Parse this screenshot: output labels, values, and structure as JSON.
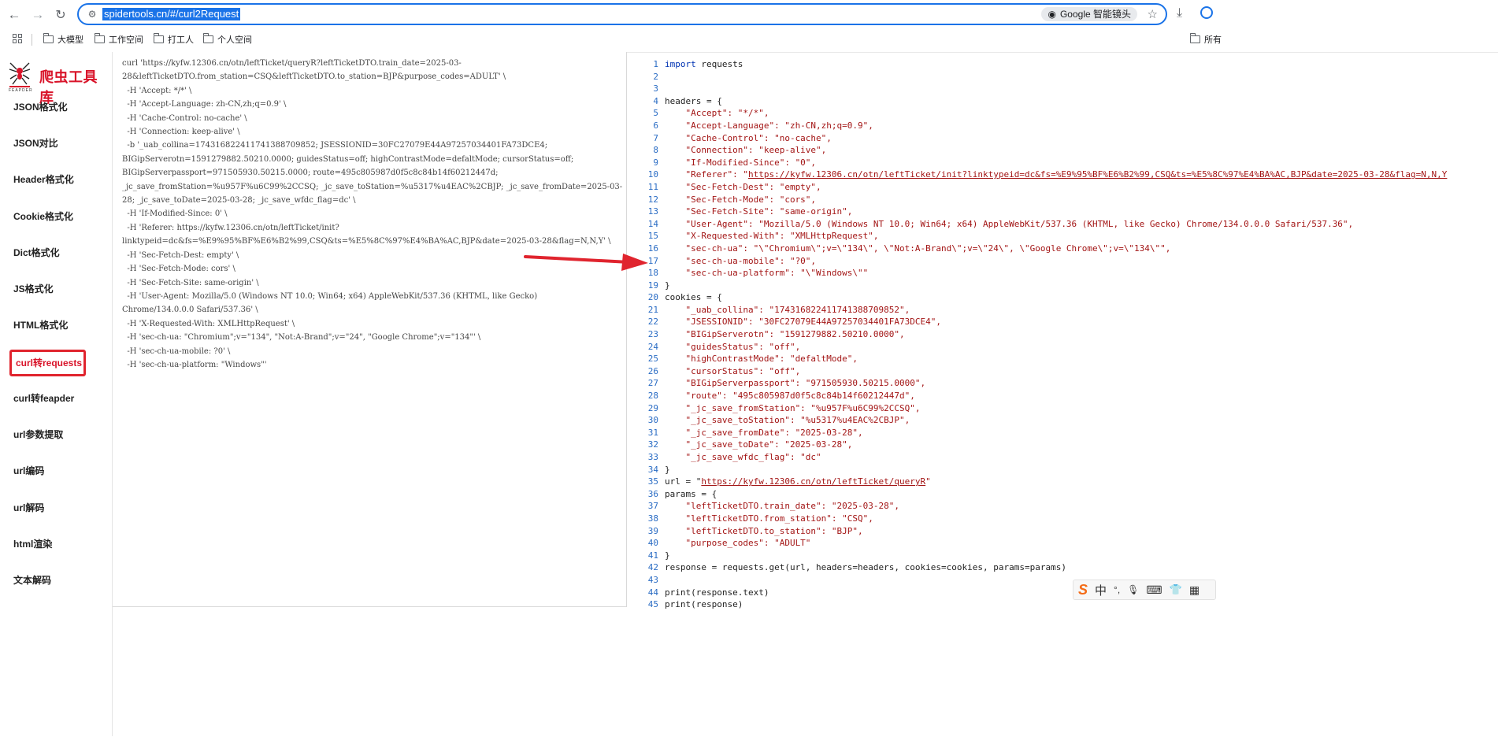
{
  "browser": {
    "url": "spidertools.cn/#/curl2Request",
    "lens_label": "Google 智能镜头"
  },
  "bookmarks": {
    "items": [
      "大模型",
      "工作空间",
      "打工人",
      "个人空间"
    ],
    "right_label": "所有"
  },
  "sidebar": {
    "logo_text": "爬虫工具库",
    "logo_sub": "FEAPDER",
    "items": [
      {
        "label": "JSON格式化"
      },
      {
        "label": "JSON对比"
      },
      {
        "label": "Header格式化"
      },
      {
        "label": "Cookie格式化"
      },
      {
        "label": "Dict格式化"
      },
      {
        "label": "JS格式化"
      },
      {
        "label": "HTML格式化"
      },
      {
        "label": "curl转requests",
        "active": true
      },
      {
        "label": "curl转feapder"
      },
      {
        "label": "url参数提取"
      },
      {
        "label": "url编码"
      },
      {
        "label": "url解码"
      },
      {
        "label": "html渲染"
      },
      {
        "label": "文本解码"
      }
    ]
  },
  "curl_input": [
    "curl 'https://kyfw.12306.cn/otn/leftTicket/queryR?leftTicketDTO.train_date=2025-03-",
    "28&leftTicketDTO.from_station=CSQ&leftTicketDTO.to_station=BJP&purpose_codes=ADULT' \\",
    "  -H 'Accept: */*' \\",
    "  -H 'Accept-Language: zh-CN,zh;q=0.9' \\",
    "  -H 'Cache-Control: no-cache' \\",
    "  -H 'Connection: keep-alive' \\",
    "  -b '_uab_collina=174316822411741388709852; JSESSIONID=30FC27079E44A97257034401FA73DCE4;",
    "BIGipServerotn=1591279882.50210.0000; guidesStatus=off; highContrastMode=defaltMode; cursorStatus=off;",
    "BIGipServerpassport=971505930.50215.0000; route=495c805987d0f5c8c84b14f60212447d;",
    "_jc_save_fromStation=%u957F%u6C99%2CCSQ; _jc_save_toStation=%u5317%u4EAC%2CBJP; _jc_save_fromDate=2025-03-",
    "28; _jc_save_toDate=2025-03-28; _jc_save_wfdc_flag=dc' \\",
    "  -H 'If-Modified-Since: 0' \\",
    "  -H 'Referer: https://kyfw.12306.cn/otn/leftTicket/init?",
    "linktypeid=dc&fs=%E9%95%BF%E6%B2%99,CSQ&ts=%E5%8C%97%E4%BA%AC,BJP&date=2025-03-28&flag=N,N,Y' \\",
    "  -H 'Sec-Fetch-Dest: empty' \\",
    "  -H 'Sec-Fetch-Mode: cors' \\",
    "  -H 'Sec-Fetch-Site: same-origin' \\",
    "  -H 'User-Agent: Mozilla/5.0 (Windows NT 10.0; Win64; x64) AppleWebKit/537.36 (KHTML, like Gecko)",
    "Chrome/134.0.0.0 Safari/537.36' \\",
    "  -H 'X-Requested-With: XMLHttpRequest' \\",
    "  -H 'sec-ch-ua: \"Chromium\";v=\"134\", \"Not:A-Brand\";v=\"24\", \"Google Chrome\";v=\"134\"' \\",
    "  -H 'sec-ch-ua-mobile: ?0' \\",
    "  -H 'sec-ch-ua-platform: \"Windows\"'"
  ],
  "code_lines": [
    {
      "n": "1",
      "t": "import requests",
      "k": "import"
    },
    {
      "n": "2",
      "t": ""
    },
    {
      "n": "3",
      "t": ""
    },
    {
      "n": "4",
      "t": "headers = {"
    },
    {
      "n": "5",
      "t": "    \"Accept\": \"*/*\",",
      "s": true
    },
    {
      "n": "6",
      "t": "    \"Accept-Language\": \"zh-CN,zh;q=0.9\",",
      "s": true
    },
    {
      "n": "7",
      "t": "    \"Cache-Control\": \"no-cache\",",
      "s": true
    },
    {
      "n": "8",
      "t": "    \"Connection\": \"keep-alive\",",
      "s": true
    },
    {
      "n": "9",
      "t": "    \"If-Modified-Since\": \"0\",",
      "s": true
    },
    {
      "n": "10",
      "t": "    \"Referer\": \"",
      "s": true,
      "link": "https://kyfw.12306.cn/otn/leftTicket/init?linktypeid=dc&fs=%E9%95%BF%E6%B2%99,CSQ&ts=%E5%8C%97%E4%BA%AC,BJP&date=2025-03-28&flag=N,N,Y"
    },
    {
      "n": "11",
      "t": "    \"Sec-Fetch-Dest\": \"empty\",",
      "s": true
    },
    {
      "n": "12",
      "t": "    \"Sec-Fetch-Mode\": \"cors\",",
      "s": true
    },
    {
      "n": "13",
      "t": "    \"Sec-Fetch-Site\": \"same-origin\",",
      "s": true
    },
    {
      "n": "14",
      "t": "    \"User-Agent\": \"Mozilla/5.0 (Windows NT 10.0; Win64; x64) AppleWebKit/537.36 (KHTML, like Gecko) Chrome/134.0.0.0 Safari/537.36\",",
      "s": true
    },
    {
      "n": "15",
      "t": "    \"X-Requested-With\": \"XMLHttpRequest\",",
      "s": true
    },
    {
      "n": "16",
      "t": "    \"sec-ch-ua\": \"\\\"Chromium\\\";v=\\\"134\\\", \\\"Not:A-Brand\\\";v=\\\"24\\\", \\\"Google Chrome\\\";v=\\\"134\\\"\",",
      "s": true
    },
    {
      "n": "17",
      "t": "    \"sec-ch-ua-mobile\": \"?0\",",
      "s": true
    },
    {
      "n": "18",
      "t": "    \"sec-ch-ua-platform\": \"\\\"Windows\\\"\"",
      "s": true
    },
    {
      "n": "19",
      "t": "}"
    },
    {
      "n": "20",
      "t": "cookies = {"
    },
    {
      "n": "21",
      "t": "    \"_uab_collina\": \"174316822411741388709852\",",
      "s": true
    },
    {
      "n": "22",
      "t": "    \"JSESSIONID\": \"30FC27079E44A97257034401FA73DCE4\",",
      "s": true
    },
    {
      "n": "23",
      "t": "    \"BIGipServerotn\": \"1591279882.50210.0000\",",
      "s": true
    },
    {
      "n": "24",
      "t": "    \"guidesStatus\": \"off\",",
      "s": true
    },
    {
      "n": "25",
      "t": "    \"highContrastMode\": \"defaltMode\",",
      "s": true
    },
    {
      "n": "26",
      "t": "    \"cursorStatus\": \"off\",",
      "s": true
    },
    {
      "n": "27",
      "t": "    \"BIGipServerpassport\": \"971505930.50215.0000\",",
      "s": true
    },
    {
      "n": "28",
      "t": "    \"route\": \"495c805987d0f5c8c84b14f60212447d\",",
      "s": true
    },
    {
      "n": "29",
      "t": "    \"_jc_save_fromStation\": \"%u957F%u6C99%2CCSQ\",",
      "s": true
    },
    {
      "n": "30",
      "t": "    \"_jc_save_toStation\": \"%u5317%u4EAC%2CBJP\",",
      "s": true
    },
    {
      "n": "31",
      "t": "    \"_jc_save_fromDate\": \"2025-03-28\",",
      "s": true
    },
    {
      "n": "32",
      "t": "    \"_jc_save_toDate\": \"2025-03-28\",",
      "s": true
    },
    {
      "n": "33",
      "t": "    \"_jc_save_wfdc_flag\": \"dc\"",
      "s": true
    },
    {
      "n": "34",
      "t": "}"
    },
    {
      "n": "35",
      "t": "url = \"",
      "link": "https://kyfw.12306.cn/otn/leftTicket/queryR",
      "tail": "\""
    },
    {
      "n": "36",
      "t": "params = {"
    },
    {
      "n": "37",
      "t": "    \"leftTicketDTO.train_date\": \"2025-03-28\",",
      "s": true
    },
    {
      "n": "38",
      "t": "    \"leftTicketDTO.from_station\": \"CSQ\",",
      "s": true
    },
    {
      "n": "39",
      "t": "    \"leftTicketDTO.to_station\": \"BJP\",",
      "s": true
    },
    {
      "n": "40",
      "t": "    \"purpose_codes\": \"ADULT\"",
      "s": true
    },
    {
      "n": "41",
      "t": "}"
    },
    {
      "n": "42",
      "t": "response = requests.get(url, headers=headers, cookies=cookies, params=params)"
    },
    {
      "n": "43",
      "t": ""
    },
    {
      "n": "44",
      "t": "print(response.text)"
    },
    {
      "n": "45",
      "t": "print(response)"
    }
  ],
  "ime": {
    "logo": "S",
    "items": [
      "中",
      "°,",
      "🎙",
      "⌨",
      "👕",
      "▦"
    ]
  },
  "colors": {
    "accent": "#d9142a",
    "highlight_border": "#e0242e",
    "arrow": "#e0242e",
    "link_blue": "#1a73e8"
  }
}
